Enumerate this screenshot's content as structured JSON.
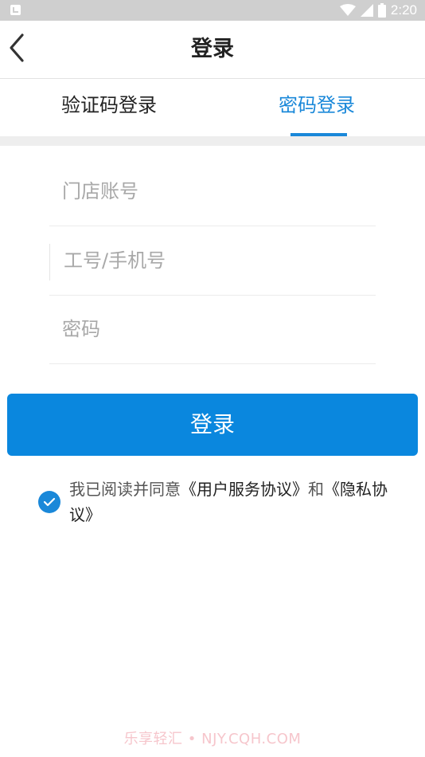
{
  "status_bar": {
    "time": "2:20",
    "icons": [
      "notification-icon",
      "wifi-icon",
      "signal-icon",
      "battery-icon"
    ]
  },
  "header": {
    "title": "登录",
    "back_icon": "chevron-left-icon"
  },
  "tabs": [
    {
      "label": "验证码登录",
      "active": false
    },
    {
      "label": "密码登录",
      "active": true
    }
  ],
  "form": {
    "store_account": {
      "placeholder": "门店账号",
      "value": ""
    },
    "employee_id": {
      "placeholder": "工号/手机号",
      "value": ""
    },
    "password": {
      "placeholder": "密码",
      "value": ""
    }
  },
  "login_button": {
    "label": "登录"
  },
  "agreement": {
    "checked": true,
    "prefix": "我已阅读并同意",
    "user_agreement": "《用户服务协议》",
    "conjunction": "和",
    "privacy_policy": "《隐私协议》"
  },
  "watermark": "乐享轻汇 • NJY.CQH.COM",
  "colors": {
    "accent": "#1a88d9",
    "button": "#0a87de",
    "status_bar": "#cfcfcf"
  }
}
